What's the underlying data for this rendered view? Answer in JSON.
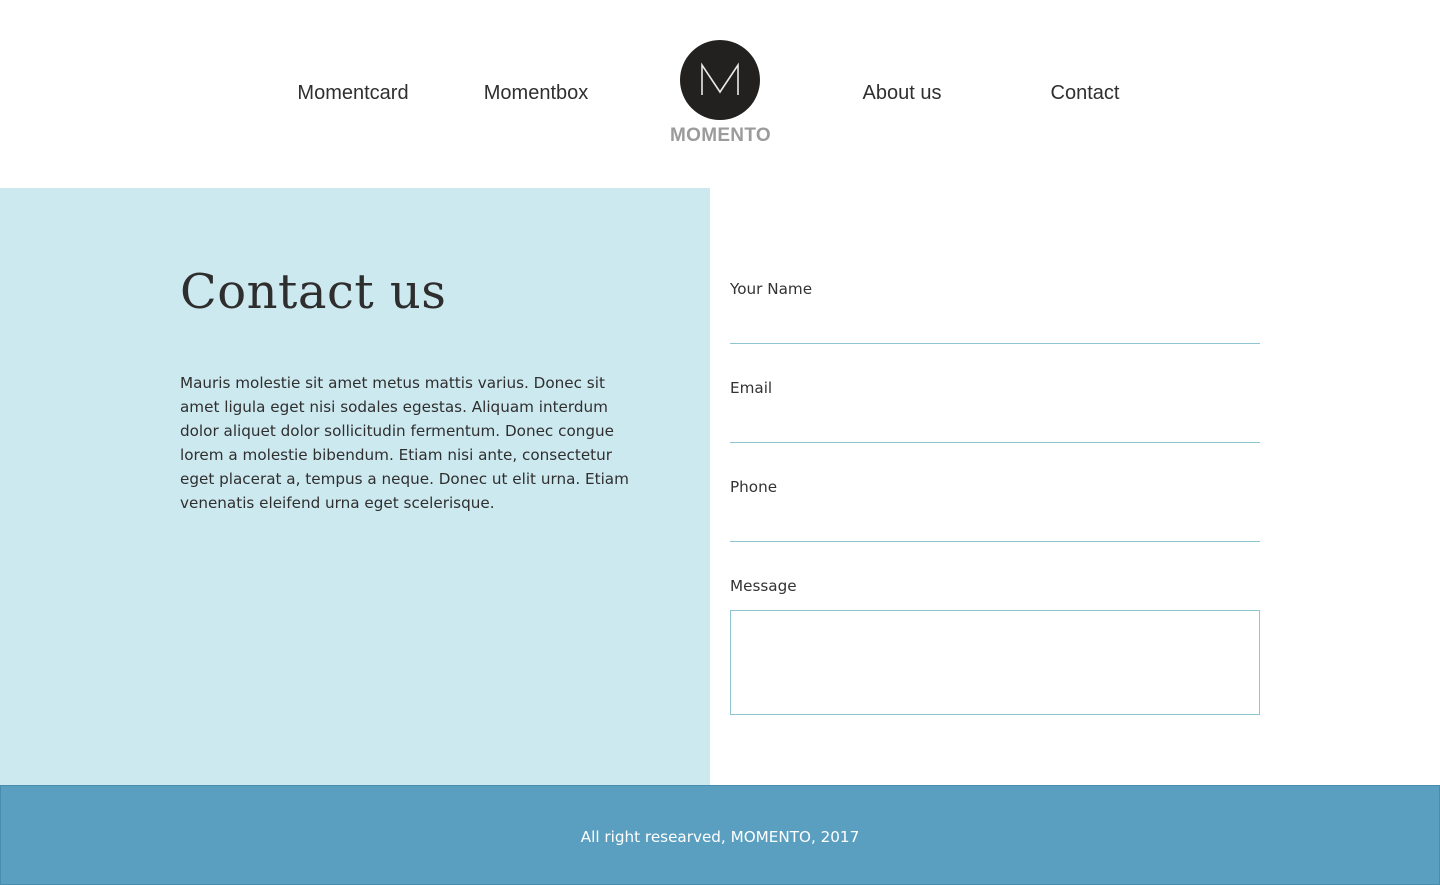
{
  "nav": {
    "items": [
      {
        "label": "Momentcard"
      },
      {
        "label": "Momentbox"
      },
      {
        "label": "About us"
      },
      {
        "label": "Contact"
      }
    ]
  },
  "logo": {
    "text": "MOMENTO",
    "icon": "m-monogram-icon"
  },
  "contact": {
    "title": "Contact us",
    "intro": "Mauris molestie sit amet metus mattis varius. Donec sit amet ligula eget nisi sodales egestas. Aliquam interdum dolor aliquet dolor sollicitudin fermentum. Donec congue lorem a molestie bibendum. Etiam nisi ante, consectetur eget placerat a, tempus a neque. Donec ut elit urna. Etiam venenatis eleifend urna eget scelerisque."
  },
  "form": {
    "name_label": "Your Name",
    "name_value": "",
    "email_label": "Email",
    "email_value": "",
    "phone_label": "Phone",
    "phone_value": "",
    "message_label": "Message",
    "message_value": ""
  },
  "footer": {
    "text": "All right researved, MOMENTO, 2017"
  },
  "colors": {
    "left_panel": "#cde9f0",
    "footer": "#5a9fc0",
    "input_border": "#8fc4d4",
    "logo_circle": "#222120"
  }
}
